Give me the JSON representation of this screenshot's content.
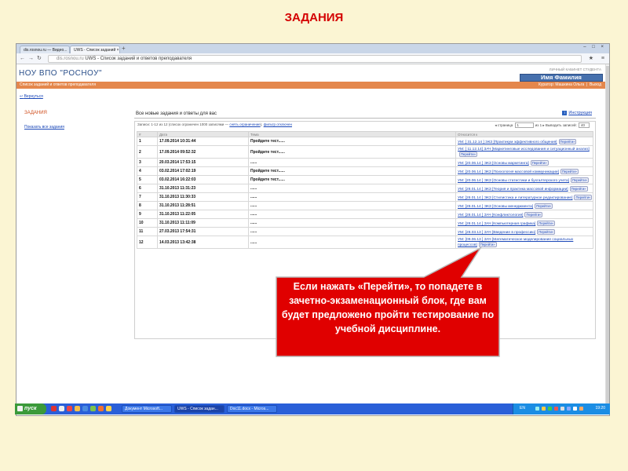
{
  "slide": {
    "title": "ЗАДАНИЯ"
  },
  "browser": {
    "tabs": [
      {
        "label": "dis.rosnou.ru — Видео..."
      },
      {
        "label": "UWS - Список заданий ×"
      }
    ],
    "new_tab": "+",
    "window_controls": "– □ ×",
    "address_host": "dis.rosnou.ru",
    "address_title": "UWS - Список заданий и ответов преподавателя"
  },
  "site": {
    "name": "НОУ ВПО \"РОСНОУ\"",
    "cabinet_label": "ЛИЧНЫЙ КАБИНЕТ СТУДЕНТА",
    "user_name": "Имя Фамилия",
    "breadcrumb": "Список заданий и ответов преподавателя",
    "curator": "Куратор: Машкина Ольга",
    "exit": "Выход"
  },
  "back_link": "Вернуться",
  "sidebar": {
    "title": "ЗАДАНИЯ",
    "show_all": "Показать все задания"
  },
  "main": {
    "title": "Все новые задания и ответы для вас",
    "instructions": "Инструкция",
    "filter_prefix": "Записи: 1-12 из 12 (список ограничен 1000 записями — ",
    "filter_link1": "снять ограничение",
    "filter_link2": "фильтр отключен",
    "pager_page": "страница",
    "pager_page_value": "1",
    "pager_of": "из 1",
    "pager_show": "Выводить записей:",
    "pager_show_value": "40"
  },
  "table": {
    "headers": [
      "#",
      "Дата",
      "Тема",
      "Относится к"
    ],
    "go_label": "Перейти»",
    "rows": [
      {
        "num": "1",
        "date": "17.09.2014 10:31:44",
        "theme": "Пройдите тест......",
        "subject": "УМ: [ 31.12.14 ] ЭКЗ [Практикум эффективного общения]"
      },
      {
        "num": "2",
        "date": "17.09.2014 09:52:32",
        "theme": "Пройдите тест......",
        "subject": "УМ: [ 11.12.14] ЗАЧ [Маркетинговые исследования и ситуационный анализ]"
      },
      {
        "num": "3",
        "date": "20.03.2014 17:53:15",
        "theme": "......",
        "subject": "УМ: [20.06.14 ] ЭКЗ [Основы маркетинга]"
      },
      {
        "num": "4",
        "date": "03.02.2014 17:02:19",
        "theme": "Пройдите тест......",
        "subject": "УМ: [20.06.14 ] ЭКЗ [Психология массовой коммуникации]"
      },
      {
        "num": "5",
        "date": "03.02.2014 16:22:03",
        "theme": "Пройдите тест......",
        "subject": "УМ: [20.06.14 ] ЭКЗ [Основы статистики и бухгалтерского учета]"
      },
      {
        "num": "6",
        "date": "31.10.2013 11:31:23",
        "theme": "......",
        "subject": "УМ: [28.01.14 ] ЭКЗ [Теория и практика массовой информации]"
      },
      {
        "num": "7",
        "date": "31.10.2013 11:30:33",
        "theme": "......",
        "subject": "УМ: [28.01.14 ] ЭКЗ [Стилистика и литературное редактирование]"
      },
      {
        "num": "8",
        "date": "31.10.2013 11:28:51",
        "theme": "......",
        "subject": "УМ: [28.01.14 ] ЭКЗ [Основы менеджмента]"
      },
      {
        "num": "9",
        "date": "31.10.2013 11:22:05",
        "theme": "......",
        "subject": "УМ: [28.01.14 ] ЗАЧ [Конфликтология]"
      },
      {
        "num": "10",
        "date": "31.10.2013 11:11:09",
        "theme": "......",
        "subject": "УМ: [28.01.14 ] ЗАЧ [Компьютерная графика]"
      },
      {
        "num": "11",
        "date": "27.03.2013 17:54:31",
        "theme": "......",
        "subject": "УМ: [28.03.13 ] ЗАЧ [Введение в профессию]"
      },
      {
        "num": "12",
        "date": "14.03.2013 13:42:38",
        "theme": "......",
        "subject": "УМ: [09.06.13 ] ЗАЧ [Математическое моделирование социальных процессов]"
      }
    ]
  },
  "callout": {
    "text": "Если нажать «Перейти», то попадете в зачетно-экзаменационный блок, где вам будет предложено пройти тестирование  по учебной дисциплине.",
    "fill_color": "#e00000",
    "border_color": "#b8b8b8"
  },
  "taskbar": {
    "start_label": "пуск",
    "tasks": [
      {
        "label": "Документ Microsoft..."
      },
      {
        "label": "UWS - Список задан..."
      },
      {
        "label": "Doc11.docx - Micros..."
      }
    ],
    "lang": "EN",
    "clock": "19:20"
  }
}
